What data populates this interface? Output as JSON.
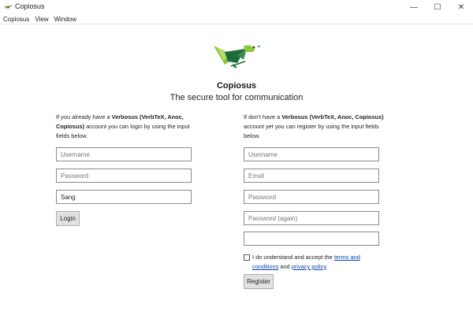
{
  "window": {
    "title": "Copiosus",
    "minimize_glyph": "—",
    "maximize_glyph": "☐",
    "close_glyph": "✕"
  },
  "menu": {
    "items": [
      "Copiosus",
      "View",
      "Window"
    ]
  },
  "header": {
    "app_name": "Copiosus",
    "tagline": "The secure tool for communication"
  },
  "login": {
    "intro_prefix": "If you already have a ",
    "intro_bold": "Verbosus (VerbTeX, Anoc, Copiosus)",
    "intro_suffix": " account you can login by using the input fields below.",
    "username_placeholder": "Username",
    "password_placeholder": "Password",
    "device_value": "Sang",
    "button_label": "Login"
  },
  "register": {
    "intro_prefix": "If don't have a ",
    "intro_bold": "Verbosus (VerbTeX, Anoc, Copiosus)",
    "intro_suffix": " account yet you can register by using the input fields below.",
    "username_placeholder": "Username",
    "email_placeholder": "Email",
    "password_placeholder": "Password",
    "password_again_placeholder": "Password (again)",
    "extra_value": "",
    "terms_prefix": "I do understand and accept the ",
    "terms_link": "terms and conditions",
    "terms_middle": " and ",
    "privacy_link": "privacy policy",
    "terms_suffix": ".",
    "button_label": "Register"
  },
  "colors": {
    "brand_green": "#8cc63f",
    "brand_dark_green": "#1e6b3a",
    "link": "#0645ad"
  }
}
